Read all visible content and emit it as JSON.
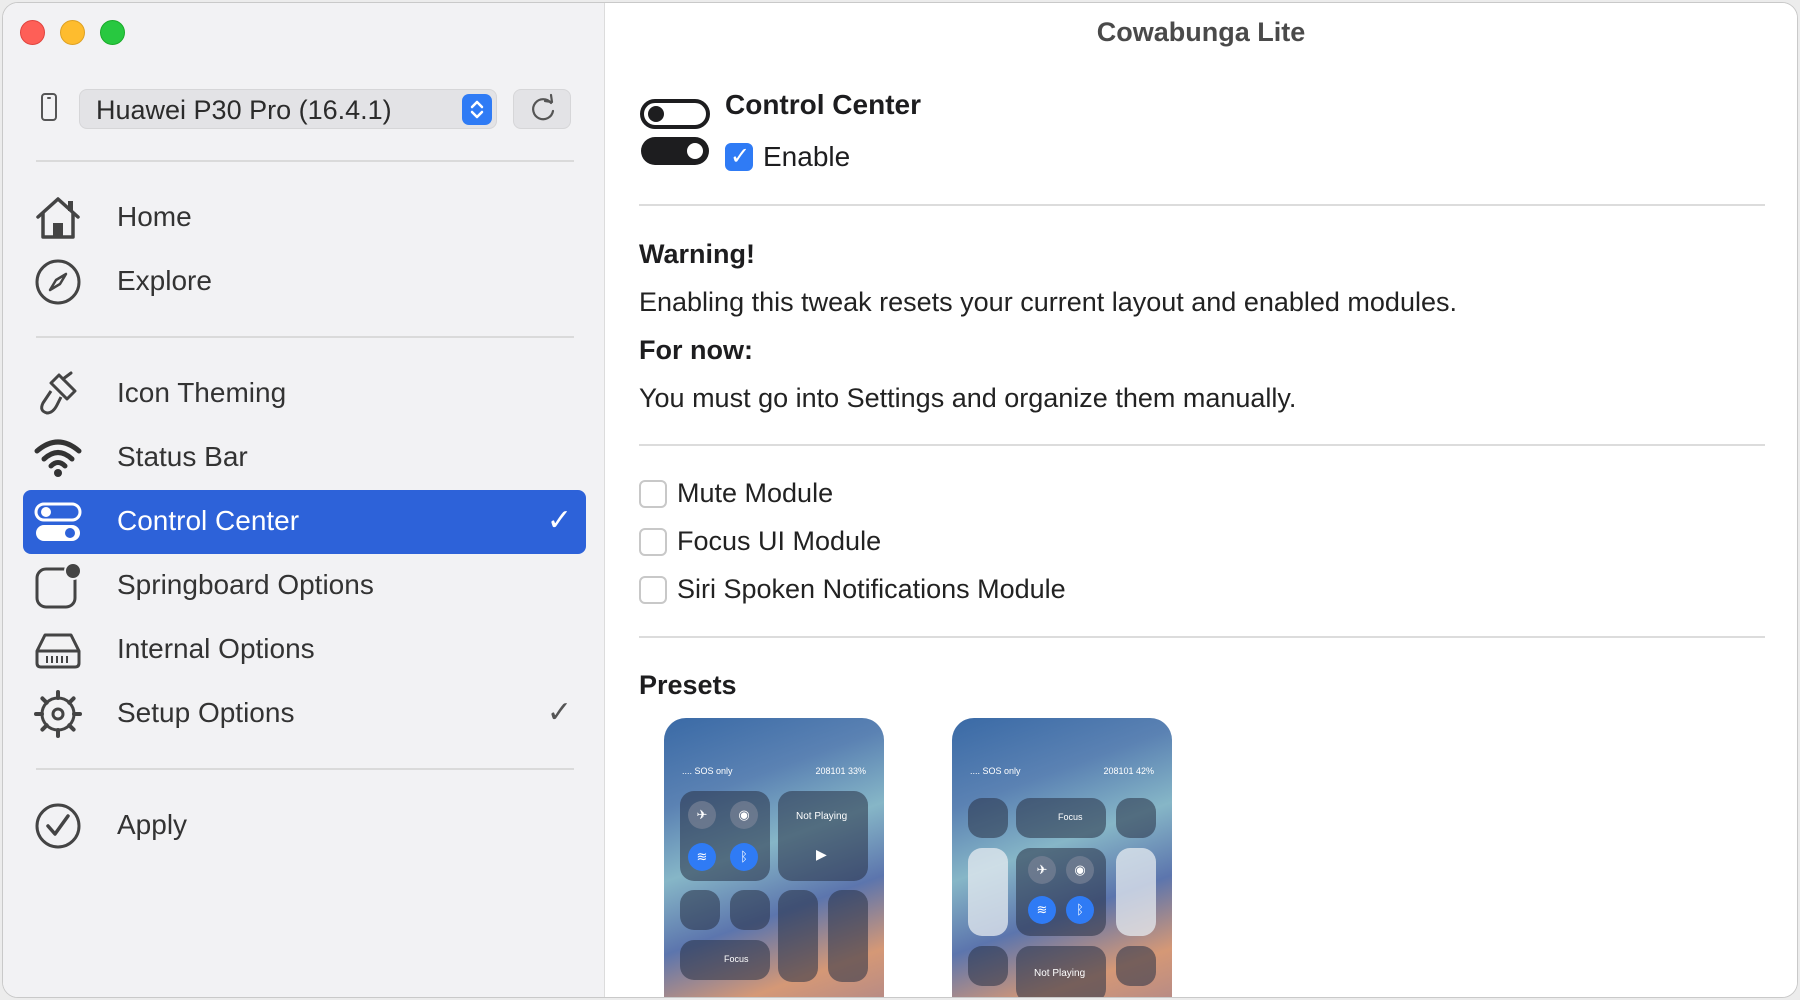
{
  "window": {
    "title": "Cowabunga Lite"
  },
  "device": {
    "selected": "Huawei P30 Pro (16.4.1)"
  },
  "sidebar": {
    "items": [
      {
        "label": "Home"
      },
      {
        "label": "Explore"
      },
      {
        "label": "Icon Theming"
      },
      {
        "label": "Status Bar"
      },
      {
        "label": "Control Center",
        "check": "✓"
      },
      {
        "label": "Springboard Options"
      },
      {
        "label": "Internal Options"
      },
      {
        "label": "Setup Options",
        "check": "✓"
      },
      {
        "label": "Apply"
      }
    ]
  },
  "main": {
    "title": "Control Center",
    "enable_label": "Enable",
    "enable_checked": true,
    "warning_title": "Warning!",
    "warning_text": "Enabling this tweak resets your current layout and enabled modules.",
    "for_now_title": "For now:",
    "for_now_text": "You must go into Settings and organize them manually.",
    "modules": [
      {
        "label": "Mute Module",
        "checked": false
      },
      {
        "label": "Focus UI Module",
        "checked": false
      },
      {
        "label": "Siri Spoken Notifications Module",
        "checked": false
      }
    ],
    "presets_title": "Presets",
    "presets": [
      {
        "status_left": ".... SOS only",
        "status_right": "208101 33%",
        "not_playing": "Not Playing",
        "focus": "Focus"
      },
      {
        "status_left": ".... SOS only",
        "status_right": "208101 42%",
        "not_playing": "Not Playing",
        "focus": "Focus"
      }
    ]
  },
  "colors": {
    "accent": "#2d62d9",
    "checkbox": "#2f7bf5"
  }
}
